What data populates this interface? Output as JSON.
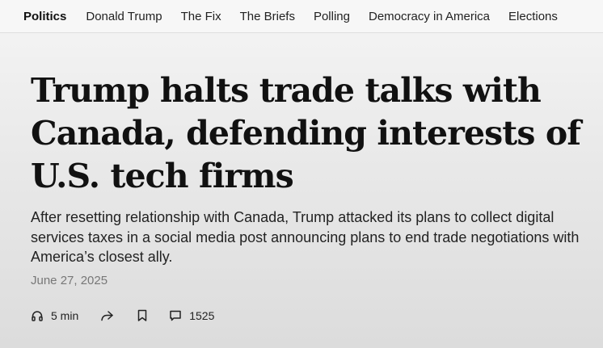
{
  "nav": {
    "items": [
      "Politics",
      "Donald Trump",
      "The Fix",
      "The Briefs",
      "Polling",
      "Democracy in America",
      "Elections"
    ]
  },
  "article": {
    "headline": "Trump halts trade talks with Canada, defending interests of U.S. tech firms",
    "dek": "After resetting relationship with Canada, Trump attacked its plans to collect digital services taxes in a social media post announcing plans to end trade negotiations with America’s closest ally.",
    "date": "June 27, 2025"
  },
  "actions": {
    "listen": {
      "icon": "headphones-icon",
      "label": "5 min"
    },
    "share": {
      "icon": "share-icon"
    },
    "save": {
      "icon": "bookmark-icon"
    },
    "comments": {
      "icon": "comment-icon",
      "count": "1525"
    }
  }
}
